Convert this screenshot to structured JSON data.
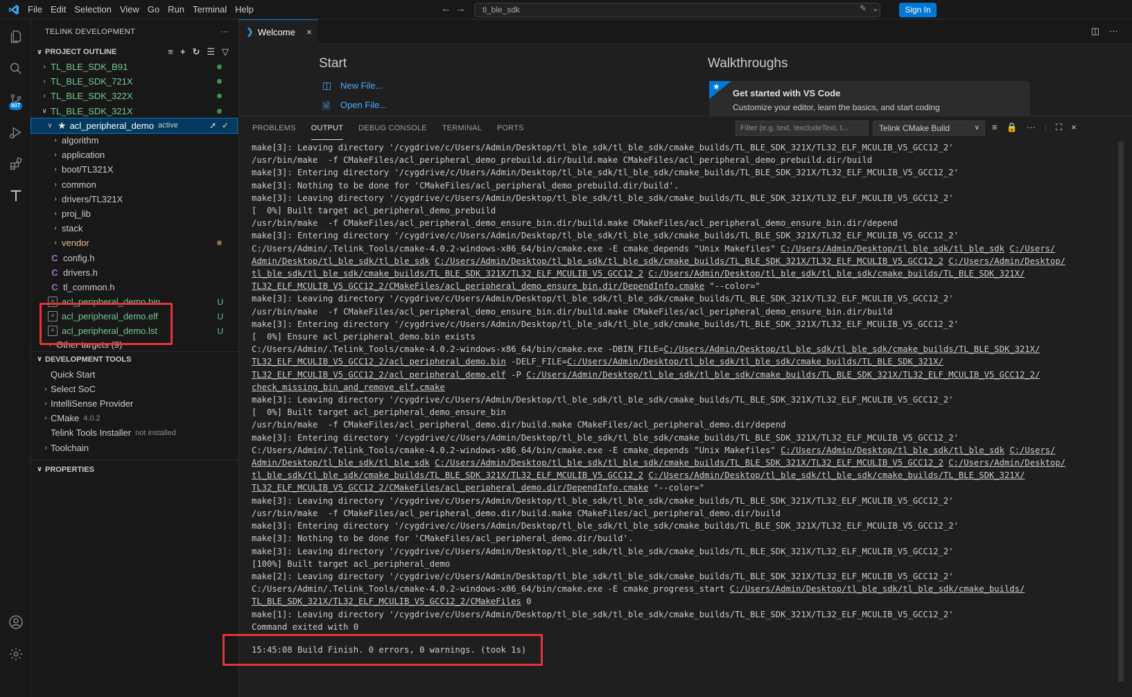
{
  "menu": [
    "File",
    "Edit",
    "Selection",
    "View",
    "Go",
    "Run",
    "Terminal",
    "Help"
  ],
  "search": {
    "value": "tl_ble_sdk"
  },
  "signin_label": "Sign In",
  "activity": {
    "scm_badge": "607"
  },
  "sidebar": {
    "title": "TELINK DEVELOPMENT",
    "project_outline": "PROJECT OUTLINE",
    "projects": [
      "TL_BLE_SDK_B91",
      "TL_BLE_SDK_721X",
      "TL_BLE_SDK_322X",
      "TL_BLE_SDK_321X"
    ],
    "active_project": {
      "name": "acl_peripheral_demo",
      "tag": "active"
    },
    "folders": [
      "algorithm",
      "application",
      "boot/TL321X",
      "common",
      "drivers/TL321X",
      "proj_lib",
      "stack",
      "vendor"
    ],
    "cfiles": [
      "config.h",
      "drivers.h",
      "tl_common.h"
    ],
    "outputs": [
      {
        "name": "acl_peripheral_demo.bin",
        "status": "U"
      },
      {
        "name": "acl_peripheral_demo.elf",
        "status": "U"
      },
      {
        "name": "acl_peripheral_demo.lst",
        "status": "U"
      }
    ],
    "other_targets": "Other targets (9)",
    "dev_tools": "DEVELOPMENT TOOLS",
    "tools": [
      {
        "label": "Quick Start",
        "hint": ""
      },
      {
        "label": "Select SoC",
        "hint": ""
      },
      {
        "label": "IntelliSense Provider",
        "hint": ""
      },
      {
        "label": "CMake",
        "hint": "4.0.2"
      },
      {
        "label": "Telink Tools Installer",
        "hint": "not installed"
      },
      {
        "label": "Toolchain",
        "hint": ""
      }
    ],
    "properties": "PROPERTIES"
  },
  "editor": {
    "tab": "Welcome",
    "start": "Start",
    "new_file": "New File...",
    "open_file": "Open File...",
    "walkthroughs": "Walkthroughs",
    "card_title": "Get started with VS Code",
    "card_desc": "Customize your editor, learn the basics, and start coding"
  },
  "panel": {
    "tabs": [
      "PROBLEMS",
      "OUTPUT",
      "DEBUG CONSOLE",
      "TERMINAL",
      "PORTS"
    ],
    "filter_placeholder": "Filter (e.g. text, !excludeText, t...",
    "channel": "Telink CMake Build",
    "final_line": "15:45:08 Build Finish. 0 errors, 0 warnings. (took 1s)"
  },
  "output_lines": [
    [
      [
        "make[3]: Leaving directory '/cygdrive/c/Users/Admin/Desktop/tl_ble_sdk/tl_ble_sdk/cmake_builds/TL_BLE_SDK_321X/TL32_ELF_MCULIB_V5_GCC12_2'",
        0
      ]
    ],
    [
      [
        "/usr/bin/make  -f CMakeFiles/acl_peripheral_demo_prebuild.dir/build.make CMakeFiles/acl_peripheral_demo_prebuild.dir/build",
        0
      ]
    ],
    [
      [
        "make[3]: Entering directory '/cygdrive/c/Users/Admin/Desktop/tl_ble_sdk/tl_ble_sdk/cmake_builds/TL_BLE_SDK_321X/TL32_ELF_MCULIB_V5_GCC12_2'",
        0
      ]
    ],
    [
      [
        "make[3]: Nothing to be done for 'CMakeFiles/acl_peripheral_demo_prebuild.dir/build'.",
        0
      ]
    ],
    [
      [
        "make[3]: Leaving directory '/cygdrive/c/Users/Admin/Desktop/tl_ble_sdk/tl_ble_sdk/cmake_builds/TL_BLE_SDK_321X/TL32_ELF_MCULIB_V5_GCC12_2'",
        0
      ]
    ],
    [
      [
        "[  0%] Built target acl_peripheral_demo_prebuild",
        0
      ]
    ],
    [
      [
        "/usr/bin/make  -f CMakeFiles/acl_peripheral_demo_ensure_bin.dir/build.make CMakeFiles/acl_peripheral_demo_ensure_bin.dir/depend",
        0
      ]
    ],
    [
      [
        "make[3]: Entering directory '/cygdrive/c/Users/Admin/Desktop/tl_ble_sdk/tl_ble_sdk/cmake_builds/TL_BLE_SDK_321X/TL32_ELF_MCULIB_V5_GCC12_2'",
        0
      ]
    ],
    [
      [
        "C:/Users/Admin/.Telink_Tools/cmake-4.0.2-windows-x86_64/bin/cmake.exe -E cmake_depends \"Unix Makefiles\" ",
        0
      ],
      [
        "C:/Users/Admin/Desktop/tl_ble_sdk/tl_ble_sdk",
        1
      ],
      [
        " ",
        0
      ],
      [
        "C:/Users/",
        1
      ]
    ],
    [
      [
        "Admin/Desktop/tl_ble_sdk/tl_ble_sdk",
        1
      ],
      [
        " ",
        0
      ],
      [
        "C:/Users/Admin/Desktop/tl_ble_sdk/tl_ble_sdk/cmake_builds/TL_BLE_SDK_321X/TL32_ELF_MCULIB_V5_GCC12_2",
        1
      ],
      [
        " ",
        0
      ],
      [
        "C:/Users/Admin/Desktop/",
        1
      ]
    ],
    [
      [
        "tl_ble_sdk/tl_ble_sdk/cmake_builds/TL_BLE_SDK_321X/TL32_ELF_MCULIB_V5_GCC12_2",
        1
      ],
      [
        " ",
        0
      ],
      [
        "C:/Users/Admin/Desktop/tl_ble_sdk/tl_ble_sdk/cmake_builds/TL_BLE_SDK_321X/",
        1
      ]
    ],
    [
      [
        "TL32_ELF_MCULIB_V5_GCC12_2/CMakeFiles/acl_peripheral_demo_ensure_bin.dir/DependInfo.cmake",
        1
      ],
      [
        " \"--color=\"",
        0
      ]
    ],
    [
      [
        "make[3]: Leaving directory '/cygdrive/c/Users/Admin/Desktop/tl_ble_sdk/tl_ble_sdk/cmake_builds/TL_BLE_SDK_321X/TL32_ELF_MCULIB_V5_GCC12_2'",
        0
      ]
    ],
    [
      [
        "/usr/bin/make  -f CMakeFiles/acl_peripheral_demo_ensure_bin.dir/build.make CMakeFiles/acl_peripheral_demo_ensure_bin.dir/build",
        0
      ]
    ],
    [
      [
        "make[3]: Entering directory '/cygdrive/c/Users/Admin/Desktop/tl_ble_sdk/tl_ble_sdk/cmake_builds/TL_BLE_SDK_321X/TL32_ELF_MCULIB_V5_GCC12_2'",
        0
      ]
    ],
    [
      [
        "[  0%] Ensure acl_peripheral_demo.bin exists",
        0
      ]
    ],
    [
      [
        "C:/Users/Admin/.Telink_Tools/cmake-4.0.2-windows-x86_64/bin/cmake.exe -DBIN_FILE=",
        0
      ],
      [
        "C:/Users/Admin/Desktop/tl_ble_sdk/tl_ble_sdk/cmake_builds/TL_BLE_SDK_321X/",
        1
      ]
    ],
    [
      [
        "TL32_ELF_MCULIB_V5_GCC12_2/acl_peripheral_demo.bin",
        1
      ],
      [
        " -DELF_FILE=",
        0
      ],
      [
        "C:/Users/Admin/Desktop/tl_ble_sdk/tl_ble_sdk/cmake_builds/TL_BLE_SDK_321X/",
        1
      ]
    ],
    [
      [
        "TL32_ELF_MCULIB_V5_GCC12_2/acl_peripheral_demo.elf",
        1
      ],
      [
        " -P ",
        0
      ],
      [
        "C:/Users/Admin/Desktop/tl_ble_sdk/tl_ble_sdk/cmake_builds/TL_BLE_SDK_321X/TL32_ELF_MCULIB_V5_GCC12_2/",
        1
      ]
    ],
    [
      [
        "check_missing_bin_and_remove_elf.cmake",
        1
      ]
    ],
    [
      [
        "make[3]: Leaving directory '/cygdrive/c/Users/Admin/Desktop/tl_ble_sdk/tl_ble_sdk/cmake_builds/TL_BLE_SDK_321X/TL32_ELF_MCULIB_V5_GCC12_2'",
        0
      ]
    ],
    [
      [
        "[  0%] Built target acl_peripheral_demo_ensure_bin",
        0
      ]
    ],
    [
      [
        "/usr/bin/make  -f CMakeFiles/acl_peripheral_demo.dir/build.make CMakeFiles/acl_peripheral_demo.dir/depend",
        0
      ]
    ],
    [
      [
        "make[3]: Entering directory '/cygdrive/c/Users/Admin/Desktop/tl_ble_sdk/tl_ble_sdk/cmake_builds/TL_BLE_SDK_321X/TL32_ELF_MCULIB_V5_GCC12_2'",
        0
      ]
    ],
    [
      [
        "C:/Users/Admin/.Telink_Tools/cmake-4.0.2-windows-x86_64/bin/cmake.exe -E cmake_depends \"Unix Makefiles\" ",
        0
      ],
      [
        "C:/Users/Admin/Desktop/tl_ble_sdk/tl_ble_sdk",
        1
      ],
      [
        " ",
        0
      ],
      [
        "C:/Users/",
        1
      ]
    ],
    [
      [
        "Admin/Desktop/tl_ble_sdk/tl_ble_sdk",
        1
      ],
      [
        " ",
        0
      ],
      [
        "C:/Users/Admin/Desktop/tl_ble_sdk/tl_ble_sdk/cmake_builds/TL_BLE_SDK_321X/TL32_ELF_MCULIB_V5_GCC12_2",
        1
      ],
      [
        " ",
        0
      ],
      [
        "C:/Users/Admin/Desktop/",
        1
      ]
    ],
    [
      [
        "tl_ble_sdk/tl_ble_sdk/cmake_builds/TL_BLE_SDK_321X/TL32_ELF_MCULIB_V5_GCC12_2",
        1
      ],
      [
        " ",
        0
      ],
      [
        "C:/Users/Admin/Desktop/tl_ble_sdk/tl_ble_sdk/cmake_builds/TL_BLE_SDK_321X/",
        1
      ]
    ],
    [
      [
        "TL32_ELF_MCULIB_V5_GCC12_2/CMakeFiles/acl_peripheral_demo.dir/DependInfo.cmake",
        1
      ],
      [
        " \"--color=\"",
        0
      ]
    ],
    [
      [
        "make[3]: Leaving directory '/cygdrive/c/Users/Admin/Desktop/tl_ble_sdk/tl_ble_sdk/cmake_builds/TL_BLE_SDK_321X/TL32_ELF_MCULIB_V5_GCC12_2'",
        0
      ]
    ],
    [
      [
        "/usr/bin/make  -f CMakeFiles/acl_peripheral_demo.dir/build.make CMakeFiles/acl_peripheral_demo.dir/build",
        0
      ]
    ],
    [
      [
        "make[3]: Entering directory '/cygdrive/c/Users/Admin/Desktop/tl_ble_sdk/tl_ble_sdk/cmake_builds/TL_BLE_SDK_321X/TL32_ELF_MCULIB_V5_GCC12_2'",
        0
      ]
    ],
    [
      [
        "make[3]: Nothing to be done for 'CMakeFiles/acl_peripheral_demo.dir/build'.",
        0
      ]
    ],
    [
      [
        "make[3]: Leaving directory '/cygdrive/c/Users/Admin/Desktop/tl_ble_sdk/tl_ble_sdk/cmake_builds/TL_BLE_SDK_321X/TL32_ELF_MCULIB_V5_GCC12_2'",
        0
      ]
    ],
    [
      [
        "[100%] Built target acl_peripheral_demo",
        0
      ]
    ],
    [
      [
        "make[2]: Leaving directory '/cygdrive/c/Users/Admin/Desktop/tl_ble_sdk/tl_ble_sdk/cmake_builds/TL_BLE_SDK_321X/TL32_ELF_MCULIB_V5_GCC12_2'",
        0
      ]
    ],
    [
      [
        "C:/Users/Admin/.Telink_Tools/cmake-4.0.2-windows-x86_64/bin/cmake.exe -E cmake_progress_start ",
        0
      ],
      [
        "C:/Users/Admin/Desktop/tl_ble_sdk/tl_ble_sdk/cmake_builds/",
        1
      ]
    ],
    [
      [
        "TL_BLE_SDK_321X/TL32_ELF_MCULIB_V5_GCC12_2/CMakeFiles",
        1
      ],
      [
        " 0",
        0
      ]
    ],
    [
      [
        "make[1]: Leaving directory '/cygdrive/c/Users/Admin/Desktop/tl_ble_sdk/tl_ble_sdk/cmake_builds/TL_BLE_SDK_321X/TL32_ELF_MCULIB_V5_GCC12_2'",
        0
      ]
    ],
    [
      [
        "Command exited with 0",
        0
      ]
    ]
  ]
}
